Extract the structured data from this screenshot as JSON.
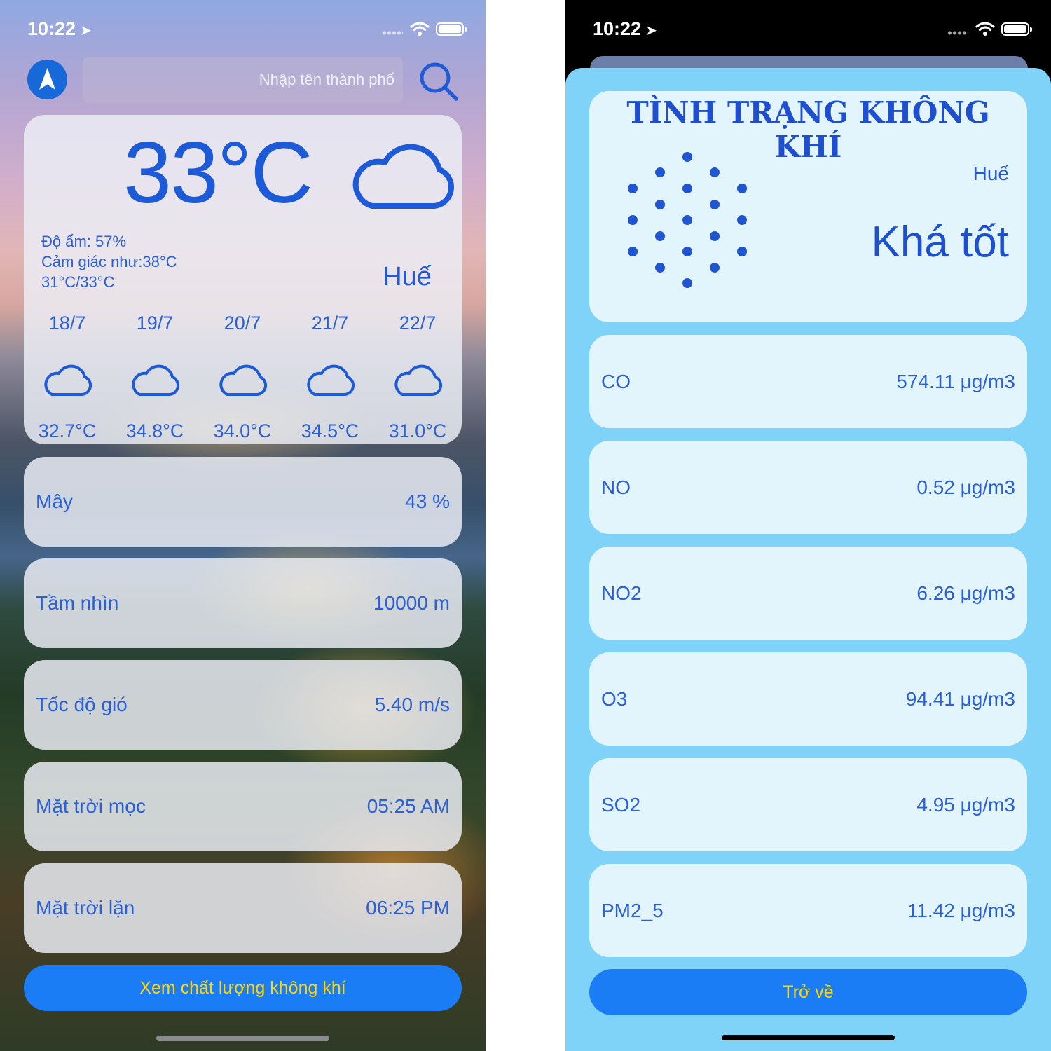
{
  "colors": {
    "accent_blue": "#1a7df5",
    "text_blue": "#2a5fd6",
    "button_text": "#ffd600",
    "sheet_bg": "#7fd2f8",
    "card_bg": "#e2f5fd"
  },
  "left": {
    "status": {
      "time": "10:22"
    },
    "search": {
      "placeholder": "Nhập tên thành phố"
    },
    "current": {
      "temperature": "33°C",
      "icon": "cloud-icon",
      "humidity": "Độ ẩm: 57%",
      "feels_like": "Cảm giác như:38°C",
      "range": "31°C/33°C",
      "city": "Huế"
    },
    "forecast": [
      {
        "date": "18/7",
        "icon": "cloud-icon",
        "temp": "32.7°C"
      },
      {
        "date": "19/7",
        "icon": "cloud-icon",
        "temp": "34.8°C"
      },
      {
        "date": "20/7",
        "icon": "cloud-icon",
        "temp": "34.0°C"
      },
      {
        "date": "21/7",
        "icon": "cloud-icon",
        "temp": "34.5°C"
      },
      {
        "date": "22/7",
        "icon": "cloud-icon",
        "temp": "31.0°C"
      }
    ],
    "stats": [
      {
        "label": "Mây",
        "value": "43 %"
      },
      {
        "label": "Tầm nhìn",
        "value": "10000 m"
      },
      {
        "label": "Tốc độ gió",
        "value": "5.40 m/s"
      },
      {
        "label": "Mặt trời mọc",
        "value": "05:25 AM"
      },
      {
        "label": "Mặt trời lặn",
        "value": "06:25 PM"
      }
    ],
    "air_quality_button": "Xem chất lượng không khí"
  },
  "right": {
    "status": {
      "time": "10:22"
    },
    "title": "TÌNH TRẠNG KHÔNG KHÍ",
    "city": "Huế",
    "quality": "Khá tốt",
    "pollutants": [
      {
        "name": "CO",
        "value": "574.11 μg/m3"
      },
      {
        "name": "NO",
        "value": "0.52 μg/m3"
      },
      {
        "name": "NO2",
        "value": "6.26 μg/m3"
      },
      {
        "name": "O3",
        "value": "94.41 μg/m3"
      },
      {
        "name": "SO2",
        "value": "4.95 μg/m3"
      },
      {
        "name": "PM2_5",
        "value": "11.42 μg/m3"
      }
    ],
    "back_button": "Trở về"
  }
}
